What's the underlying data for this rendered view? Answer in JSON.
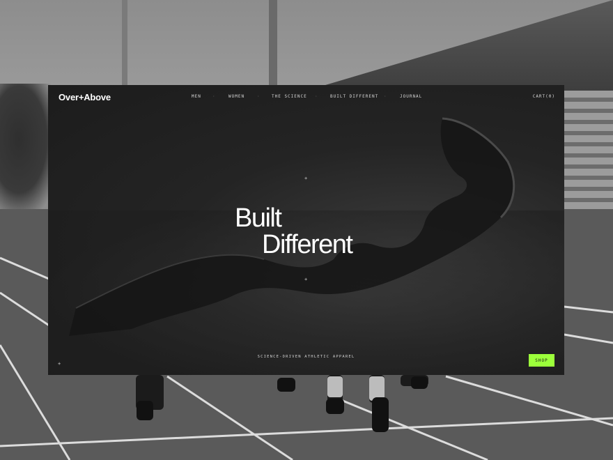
{
  "brand": {
    "logo": "Over+Above"
  },
  "nav": {
    "items": [
      {
        "label": "MEN"
      },
      {
        "label": "WOMEN"
      },
      {
        "label": "THE SCIENCE"
      },
      {
        "label": "BUILT DIFFERENT"
      },
      {
        "label": "JOURNAL"
      }
    ],
    "separator": "·",
    "cart_label": "CART(0)"
  },
  "hero": {
    "line1": "Built",
    "line2": "Different",
    "tagline": "SCIENCE-DRIVEN ATHLETIC APPAREL",
    "marker": "+"
  },
  "cta": {
    "shop_label": "SHOP"
  },
  "colors": {
    "accent": "#9cff3b",
    "panel": "#1e1e1e",
    "text": "#ffffff"
  }
}
